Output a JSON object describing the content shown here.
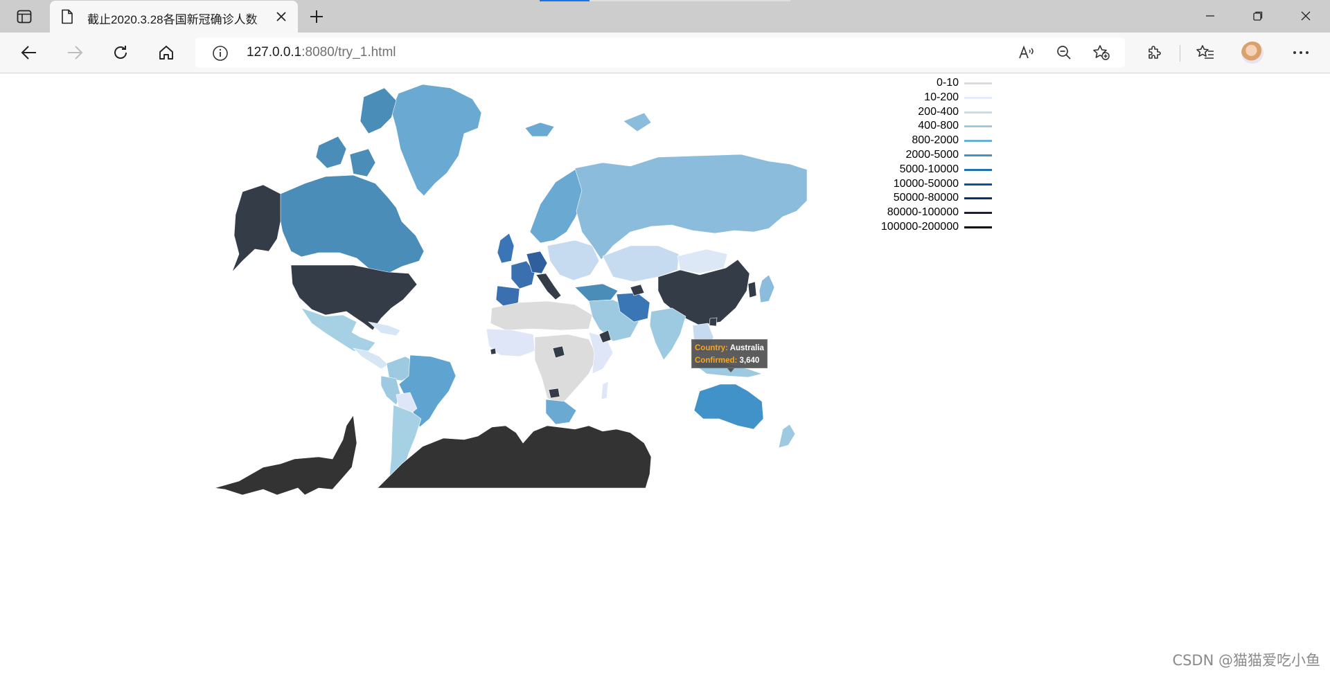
{
  "browser": {
    "tab": {
      "title": "截止2020.3.28各国新冠确诊人数"
    },
    "address": {
      "host": "127.0.0.1",
      "rest": ":8080/try_1.html"
    }
  },
  "legend": {
    "items": [
      {
        "label": "0-10",
        "color": "#dcdcdc"
      },
      {
        "label": "10-200",
        "color": "#e6ecf8"
      },
      {
        "label": "200-400",
        "color": "#c6dbef"
      },
      {
        "label": "400-800",
        "color": "#9ecae1"
      },
      {
        "label": "800-2000",
        "color": "#6baed6"
      },
      {
        "label": "2000-5000",
        "color": "#4292c6"
      },
      {
        "label": "5000-10000",
        "color": "#2171b5"
      },
      {
        "label": "10000-50000",
        "color": "#08519c"
      },
      {
        "label": "50000-80000",
        "color": "#08306b"
      },
      {
        "label": "80000-100000",
        "color": "#1e1e2e"
      },
      {
        "label": "100000-200000",
        "color": "#000000"
      }
    ]
  },
  "map_colors": {
    "greenland": "#6aa9d2",
    "canada": "#4a8db8",
    "usa": "#343c48",
    "alaska": "#343c48",
    "mexico": "#a6d0e4",
    "central_america": "#d6e6f4",
    "colombia": "#9ecae1",
    "brazil": "#5fa4d0",
    "andes": "#9ecae1",
    "argentina": "#a6d0e4",
    "bolivia": "#dfe6f7",
    "iceland": "#6aa9d2",
    "scandinavia": "#6aa9d2",
    "uk": "#3a75b5",
    "france": "#3a6fb0",
    "spain": "#3a6fb0",
    "germany": "#2f5f9c",
    "italy": "#343c48",
    "east_europe": "#c6dbef",
    "russia": "#8bbcdc",
    "kazakhstan": "#c6dbef",
    "mongolia": "#dce8f6",
    "china": "#343c48",
    "korea": "#343c48",
    "japan": "#8bbcdc",
    "iran": "#3a75b5",
    "middle_east": "#9ecae1",
    "turkey": "#4a8db8",
    "india": "#9ecae1",
    "southeast_asia": "#c6dbef",
    "africa_north": "#dcdcdc",
    "africa_west": "#dfe6f7",
    "africa_central": "#dcdcdc",
    "africa_east": "#dfe6f7",
    "south_africa": "#6aa9d2",
    "hotspot": "#343c48",
    "australia": "#4092c8",
    "new_zealand": "#9ecae1",
    "indonesia": "#9ecae1",
    "antarctica": "#333333",
    "hover_accent": "#f5a623"
  },
  "tooltip": {
    "country_label": "Country:",
    "country_value": "Australia",
    "confirmed_label": "Confirmed:",
    "confirmed_value": "3,640"
  },
  "watermark": "CSDN @猫猫爱吃小鱼",
  "icons": {
    "tab_actions": "tab-actions-icon",
    "document": "document-icon",
    "close": "close-icon",
    "new_tab": "plus-icon",
    "minimize": "minimize-icon",
    "restore": "restore-icon",
    "window_close": "close-window-icon",
    "back": "back-arrow-icon",
    "forward": "forward-arrow-icon",
    "refresh": "refresh-icon",
    "home": "home-icon",
    "info": "info-icon",
    "read_aloud": "read-aloud-icon",
    "zoom_out": "zoom-out-icon",
    "add_favorite": "add-favorite-icon",
    "extensions": "extensions-icon",
    "favorites": "favorites-icon",
    "more": "more-icon"
  }
}
